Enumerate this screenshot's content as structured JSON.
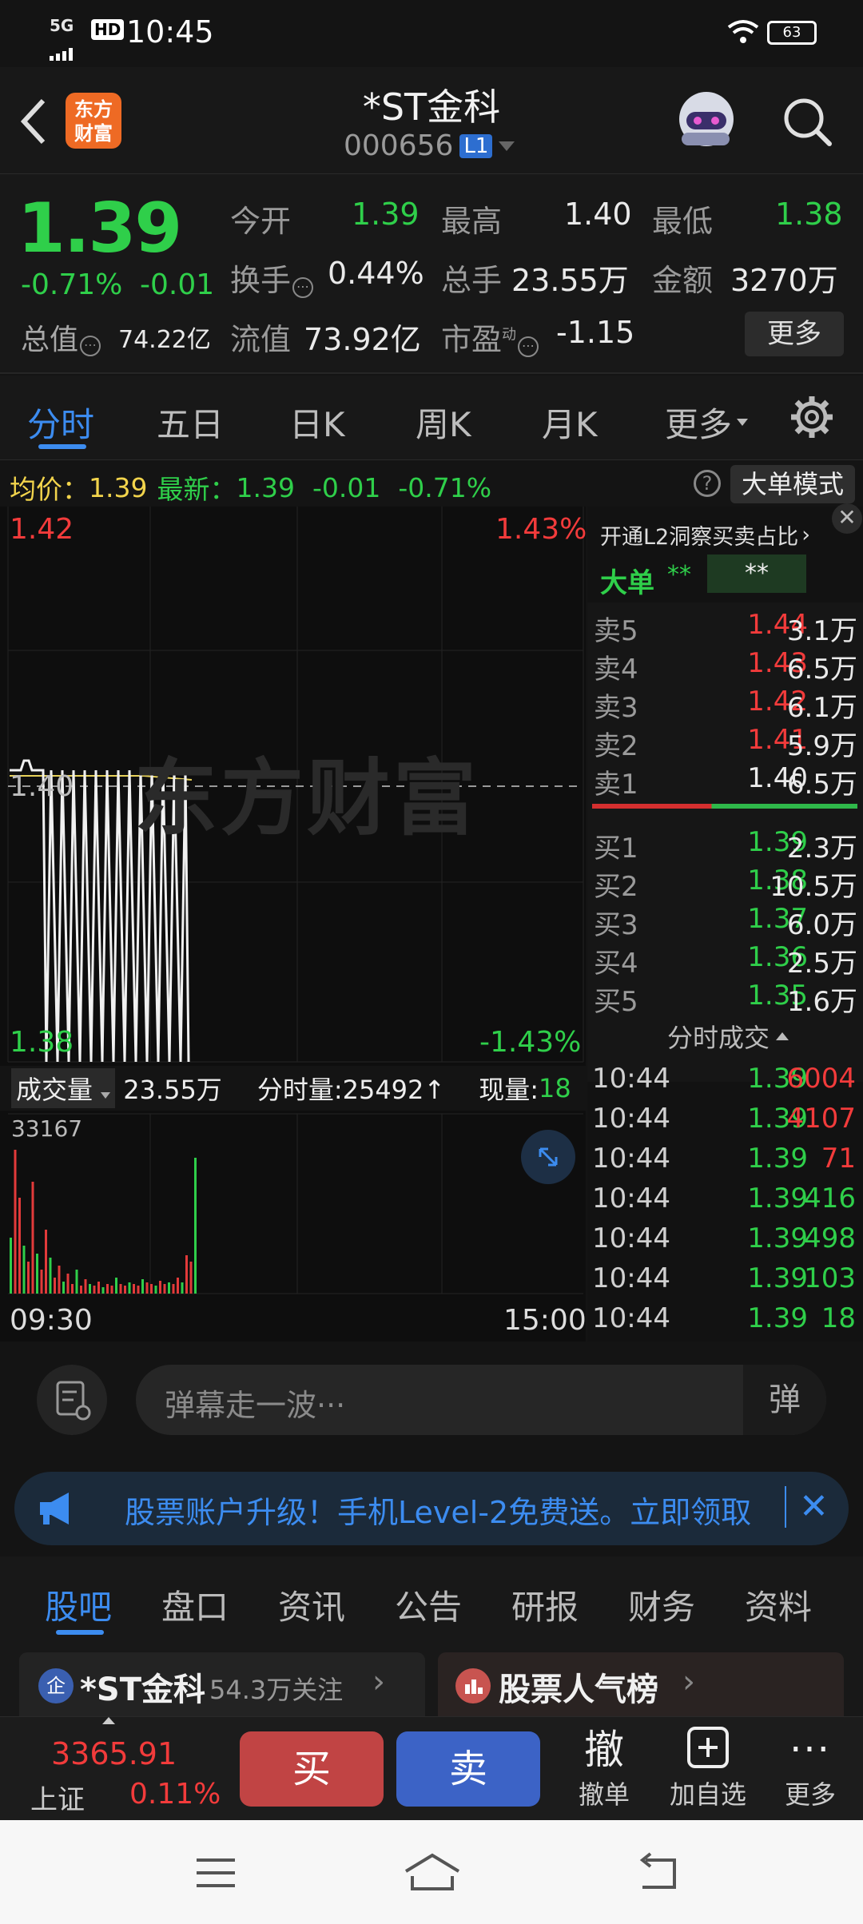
{
  "status": {
    "network": "5G",
    "hd": "HD",
    "time": "10:45",
    "battery": "63"
  },
  "header": {
    "logo_line1": "东方",
    "logo_line2": "财富",
    "title": "*ST金科",
    "code": "000656",
    "level": "L1"
  },
  "quote": {
    "price": "1.39",
    "change_pct": "-0.71%",
    "change": "-0.01",
    "open_label": "今开",
    "open": "1.39",
    "high_label": "最高",
    "high": "1.40",
    "low_label": "最低",
    "low": "1.38",
    "turnover_label": "换手",
    "turnover": "0.44%",
    "volume_label": "总手",
    "volume": "23.55万",
    "amount_label": "金额",
    "amount": "3270万",
    "mktcap_label": "总值",
    "mktcap": "74.22亿",
    "float_label": "流值",
    "float": "73.92亿",
    "pe_label": "市盈",
    "pe_sup": "动",
    "pe": "-1.15",
    "more": "更多"
  },
  "tabs": [
    {
      "label": "分时"
    },
    {
      "label": "五日"
    },
    {
      "label": "日K"
    },
    {
      "label": "周K"
    },
    {
      "label": "月K"
    },
    {
      "label": "更多"
    }
  ],
  "infobar": {
    "avg_label": "均价：",
    "avg": "1.39",
    "latest_label": "最新：",
    "latest": "1.39",
    "chg": "-0.01",
    "pct": "-0.71%",
    "mode": "大单模式"
  },
  "chart": {
    "top_price": "1.42",
    "top_pct": "1.43%",
    "mid_price": "1.40",
    "bottom_price": "1.38",
    "bottom_pct": "-1.43%",
    "watermark": "东方财富",
    "vol_label": "成交量",
    "vol_total": "23.55万",
    "fsl": "分时量:25492↑",
    "xl_label": "现量:",
    "xl": "18",
    "vol_max": "33167",
    "t_start": "09:30",
    "t_end": "15:00"
  },
  "side": {
    "l2_link": "开通L2洞察买卖占比",
    "big_order": "大单",
    "big_a": "**",
    "big_b": "**",
    "asks": [
      {
        "label": "卖5",
        "price": "1.44",
        "vol": "3.1万",
        "color": "#f23b3b"
      },
      {
        "label": "卖4",
        "price": "1.43",
        "vol": "6.5万",
        "color": "#f23b3b"
      },
      {
        "label": "卖3",
        "price": "1.42",
        "vol": "6.1万",
        "color": "#f23b3b"
      },
      {
        "label": "卖2",
        "price": "1.41",
        "vol": "5.9万",
        "color": "#f23b3b"
      },
      {
        "label": "卖1",
        "price": "1.40",
        "vol": "6.5万",
        "color": "#eaeaea"
      }
    ],
    "bids": [
      {
        "label": "买1",
        "price": "1.39",
        "vol": "2.3万"
      },
      {
        "label": "买2",
        "price": "1.38",
        "vol": "10.5万"
      },
      {
        "label": "买3",
        "price": "1.37",
        "vol": "6.0万"
      },
      {
        "label": "买4",
        "price": "1.36",
        "vol": "2.5万"
      },
      {
        "label": "买5",
        "price": "1.35",
        "vol": "1.6万"
      }
    ],
    "ticks_title": "分时成交",
    "ticks": [
      {
        "time": "10:44",
        "price": "1.39",
        "vol": "6004",
        "color": "#f23b3b"
      },
      {
        "time": "10:44",
        "price": "1.39",
        "vol": "4107",
        "color": "#f23b3b"
      },
      {
        "time": "10:44",
        "price": "1.39",
        "vol": "71",
        "color": "#f23b3b"
      },
      {
        "time": "10:44",
        "price": "1.39",
        "vol": "416",
        "color": "#2fcf4a"
      },
      {
        "time": "10:44",
        "price": "1.39",
        "vol": "498",
        "color": "#2fcf4a"
      },
      {
        "time": "10:44",
        "price": "1.39",
        "vol": "103",
        "color": "#2fcf4a"
      },
      {
        "time": "10:44",
        "price": "1.39",
        "vol": "18",
        "color": "#2fcf4a"
      }
    ]
  },
  "danmu": {
    "placeholder": "弹幕走一波···",
    "button": "弹"
  },
  "banner": {
    "text": "股票账户升级！手机Level-2免费送。立即领取"
  },
  "subtabs": [
    {
      "label": "股吧"
    },
    {
      "label": "盘口"
    },
    {
      "label": "资讯"
    },
    {
      "label": "公告"
    },
    {
      "label": "研报"
    },
    {
      "label": "财务"
    },
    {
      "label": "资料"
    }
  ],
  "cards": {
    "c1_badge": "企",
    "c1_name": "*ST金科",
    "c1_follow": "54.3万关注",
    "c2_name": "股票人气榜"
  },
  "bottom": {
    "index_value": "3365.91",
    "index_name": "上证",
    "index_pct": "0.11%",
    "buy": "买",
    "sell": "卖",
    "cancel_icon": "撤",
    "cancel": "撤单",
    "watch": "加自选",
    "more": "更多"
  }
}
